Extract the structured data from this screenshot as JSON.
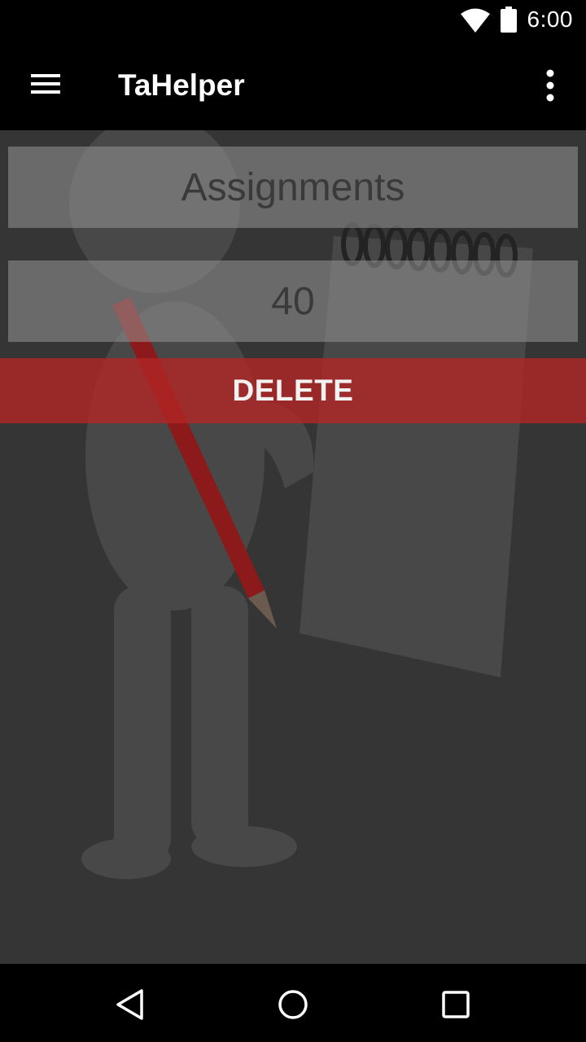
{
  "status_bar": {
    "time": "6:00",
    "icons": [
      "wifi-icon",
      "battery-icon"
    ]
  },
  "app_bar": {
    "title": "TaHelper",
    "left_icon": "hamburger-menu-icon",
    "right_icon": "overflow-menu-icon"
  },
  "form": {
    "name_value": "Assignments",
    "weight_value": "40",
    "delete_label": "DELETE"
  },
  "nav_bar": {
    "icons": [
      "back-icon",
      "home-icon",
      "recents-icon"
    ]
  },
  "colors": {
    "delete_accent": "#b02626",
    "background": "#353535"
  }
}
